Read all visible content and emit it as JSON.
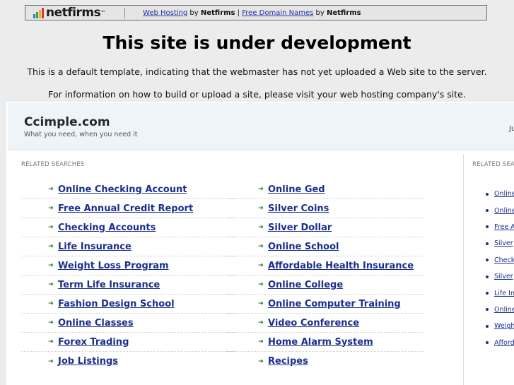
{
  "topbar": {
    "logo_text": "netfirms",
    "logo_tm": "™",
    "link1": "Web Hosting",
    "by1": " by ",
    "brand1": "Netfirms",
    "divider": " | ",
    "link2": "Free Domain Names",
    "by2": " by ",
    "brand2": "Netfirms"
  },
  "headline": "This site is under development",
  "notice1": "This is a default template, indicating that the webmaster has not yet uploaded a Web site to the server.",
  "notice2": "For information on how to build or upload a site, please visit your web hosting company's site.",
  "site": {
    "title": "Ccimple.com",
    "tagline": "What you need, when you need it",
    "header_right": "Ju"
  },
  "main": {
    "heading": "RELATED SEARCHES",
    "left": [
      "Online Checking Account",
      "Free Annual Credit Report",
      "Checking Accounts",
      "Life Insurance",
      "Weight Loss Program",
      "Term Life Insurance",
      "Fashion Design School",
      "Online Classes",
      "Forex Trading",
      "Job Listings"
    ],
    "right": [
      "Online Ged",
      "Silver Coins",
      "Silver Dollar",
      "Online School",
      "Affordable Health Insurance",
      "Online College",
      "Online Computer Training",
      "Video Conference",
      "Home Alarm System",
      "Recipes"
    ]
  },
  "side": {
    "heading": "RELATED SEA",
    "items": [
      "Online",
      "Online",
      "Free A",
      "Silver",
      "Check",
      "Silver",
      "Life In",
      "Online",
      "Weigh",
      "Afford"
    ]
  }
}
